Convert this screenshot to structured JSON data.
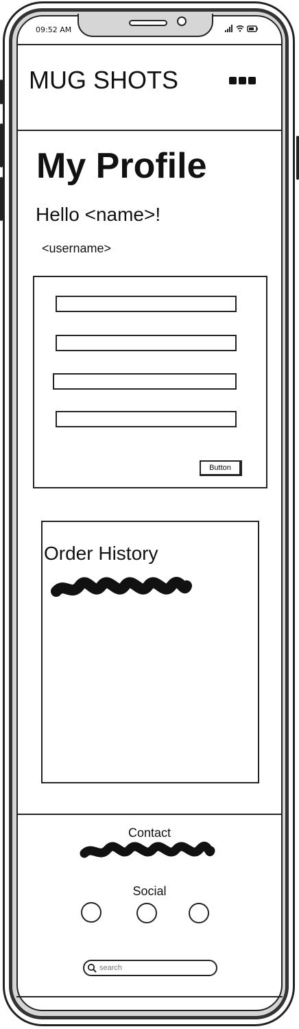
{
  "status": {
    "time": "09:52 AM"
  },
  "header": {
    "title": "MUG SHOTS",
    "menu_icon": "ellipsis-icon"
  },
  "profile": {
    "title": "My Profile",
    "greeting": "Hello <name>!",
    "username": "<username>",
    "form": {
      "fields": [
        "",
        "",
        "",
        ""
      ],
      "button_label": "Button"
    }
  },
  "orders": {
    "title": "Order History"
  },
  "footer": {
    "contact_label": "Contact",
    "social_label": "Social",
    "social_icons": [
      "social-circle-icon",
      "social-circle-icon",
      "social-circle-icon"
    ],
    "search_placeholder": "search"
  }
}
